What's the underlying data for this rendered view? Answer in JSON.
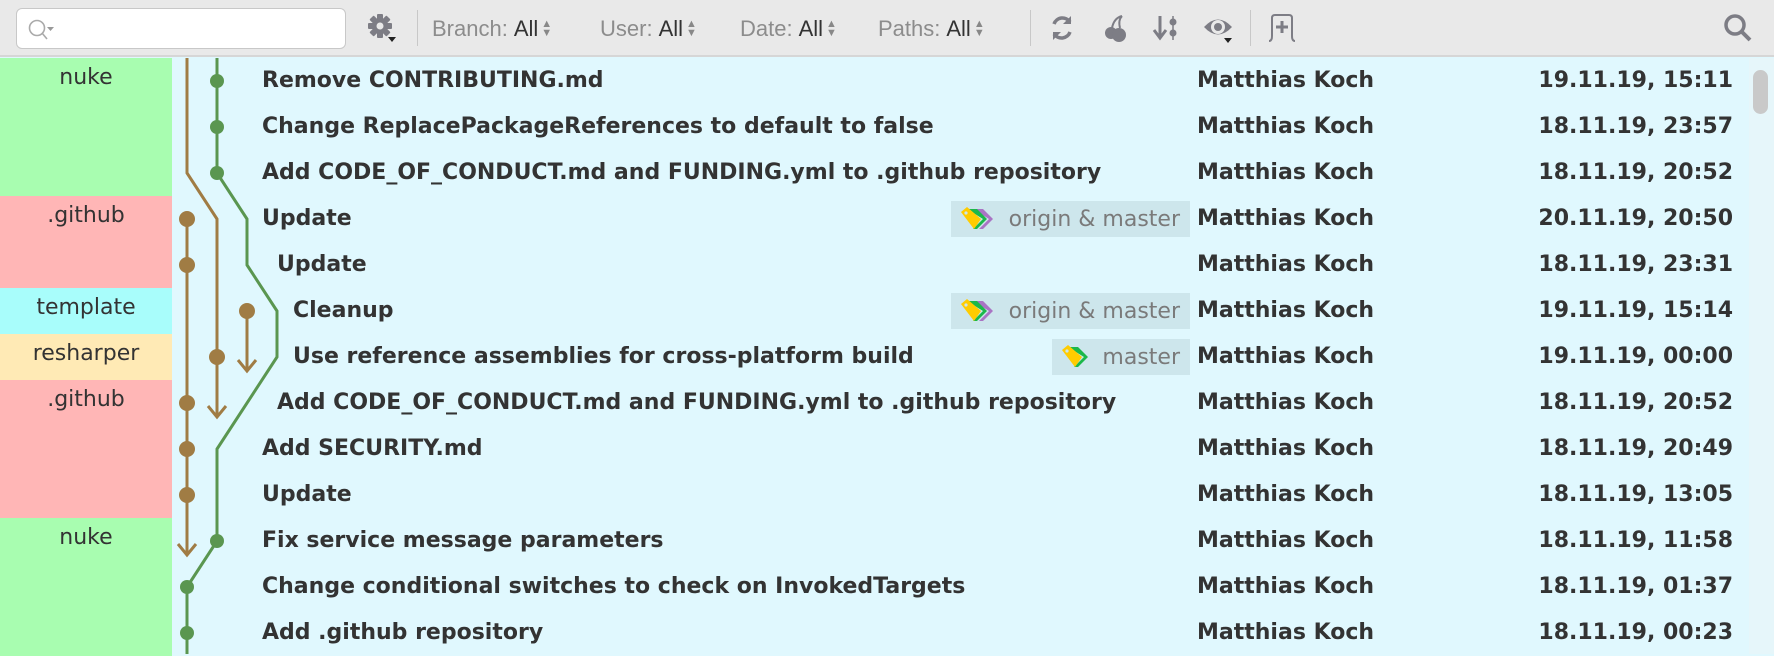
{
  "toolbar": {
    "search": {
      "placeholder": "",
      "icon": "search-dropdown-icon"
    },
    "settings_icon": "gear-icon",
    "filters": [
      {
        "label": "Branch:",
        "value": "All"
      },
      {
        "label": "User:",
        "value": "All"
      },
      {
        "label": "Date:",
        "value": "All"
      },
      {
        "label": "Paths:",
        "value": "All"
      }
    ],
    "actions": [
      "refresh-icon",
      "cherry-pick-icon",
      "sort-icon",
      "eye-icon",
      "new-tab-icon"
    ],
    "find_icon": "search-icon"
  },
  "colors": {
    "green_branch": "#5a9650",
    "brown_branch": "#a07c44",
    "nuke": "#a8fdb0",
    ".github": "#ffb6b6",
    "template": "#a8fdfb",
    "resharper": "#ffeab5",
    "row_bg": "#e0f8fe",
    "tag_bg": "#cde6ec"
  },
  "repos": [
    {
      "label": "nuke",
      "rows": 3,
      "color": "#a8fdb0"
    },
    {
      "label": ".github",
      "rows": 2,
      "color": "#ffb6b6"
    },
    {
      "label": "template",
      "rows": 1,
      "color": "#a8fdfb"
    },
    {
      "label": "resharper",
      "rows": 1,
      "color": "#ffeab5"
    },
    {
      "label": ".github",
      "rows": 3,
      "color": "#ffb6b6"
    },
    {
      "label": "nuke",
      "rows": 3,
      "color": "#a8fdb0"
    }
  ],
  "commits": [
    {
      "subject": "Remove CONTRIBUTING.md",
      "author": "Matthias Koch",
      "date": "19.11.19, 15:11"
    },
    {
      "subject": "Change ReplacePackageReferences to default to false",
      "author": "Matthias Koch",
      "date": "18.11.19, 23:57"
    },
    {
      "subject": "Add CODE_OF_CONDUCT.md and FUNDING.yml to .github repository",
      "author": "Matthias Koch",
      "date": "18.11.19, 20:52"
    },
    {
      "subject": "Update",
      "author": "Matthias Koch",
      "date": "20.11.19, 20:50",
      "tag": "origin & master"
    },
    {
      "subject": "Update",
      "author": "Matthias Koch",
      "date": "18.11.19, 23:31"
    },
    {
      "subject": "Cleanup",
      "author": "Matthias Koch",
      "date": "19.11.19, 15:14",
      "tag": "origin & master"
    },
    {
      "subject": "Use reference assemblies for cross-platform build",
      "author": "Matthias Koch",
      "date": "19.11.19, 00:00",
      "tag": "master"
    },
    {
      "subject": "Add CODE_OF_CONDUCT.md and FUNDING.yml to .github repository",
      "author": "Matthias Koch",
      "date": "18.11.19, 20:52"
    },
    {
      "subject": "Add SECURITY.md",
      "author": "Matthias Koch",
      "date": "18.11.19, 20:49"
    },
    {
      "subject": "Update",
      "author": "Matthias Koch",
      "date": "18.11.19, 13:05"
    },
    {
      "subject": "Fix service message parameters",
      "author": "Matthias Koch",
      "date": "18.11.19, 11:58"
    },
    {
      "subject": "Change conditional switches to check on InvokedTargets",
      "author": "Matthias Koch",
      "date": "18.11.19, 01:37"
    },
    {
      "subject": "Add .github repository",
      "author": "Matthias Koch",
      "date": "18.11.19, 00:23"
    }
  ]
}
